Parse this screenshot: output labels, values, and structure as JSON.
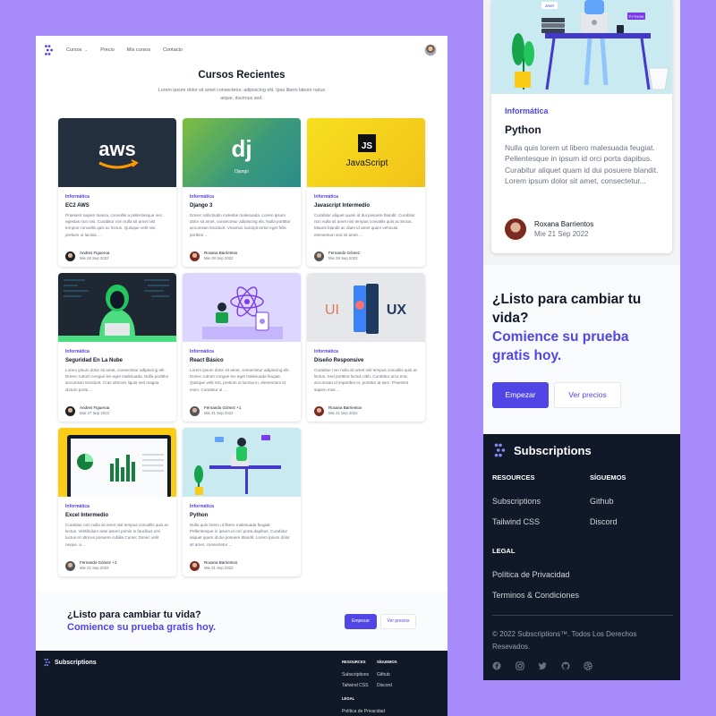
{
  "nav": {
    "links": [
      "Cursos",
      "Precio",
      "Mis cursos",
      "Contacto"
    ]
  },
  "hero": {
    "title": "Cursos Recientes",
    "subtitle": "Lorem ipsum dolor sit amet consectetur, adipisicing elit. Ipsa libero labore natus atque, ducimus sed."
  },
  "courses": [
    {
      "category": "Informática",
      "title": "EC2 AWS",
      "desc": "Praesent sapien massa, convallis a pellentesque nec, egestas non nisi. Curabitur non nulla sit amet nisl tempus convallis quis ac lectus. Quisque velit nisi, pretium ut lacinia ...",
      "author": "Andres Figueroa",
      "date": "Mie 28 Sep 2022",
      "image": "aws-logo"
    },
    {
      "category": "Informática",
      "title": "Django 3",
      "desc": "Donec sollicitudin molestie malesuada. Lorem ipsum dolor sit amet, consectetur adipiscing elit. Nulla porttitor accumsan tincidunt. Vivamus suscipit tortor eget felis porttitor ...",
      "author": "Roxana Barrientos",
      "date": "Mie 28 Sep 2022",
      "image": "django-logo"
    },
    {
      "category": "Informática",
      "title": "Javascript Intermedio",
      "desc": "Curabitur aliquet quam id dui posuere blandit. Curabitur non nulla sit amet nisl tempus convallis quis ac lectus. Mauris blandit ac diam id amet quam vehicula elementum sed sit amet ...",
      "author": "Fernando Gómez",
      "date": "Mie 28 Sep 2022",
      "image": "js-logo"
    },
    {
      "category": "Informática",
      "title": "Seguridad En La Nube",
      "desc": "Lorem ipsum dolor sit amet, consectetur adipiscing elit. Donec rutrum congue leo eget malesuada. Nulla porttitor accumsan tincidunt. Cras ultricies ligula sed magna dictum porta ...",
      "author": "Andres Figueroa",
      "date": "Mar 27 Sep 2022",
      "image": "hacker"
    },
    {
      "category": "Informática",
      "title": "React Básico",
      "desc": "Lorem ipsum dolor sit amet, consectetur adipiscing elit. Donec rutrum congue leo eget malesuada feugiat. Quisque velit nisi, pretium ut lacinia in, elementum id enim. Curabitur ul ...",
      "author": "Fernando Gómez +1",
      "date": "Mie 21 Sep 2022",
      "image": "react"
    },
    {
      "category": "Informática",
      "title": "Diseño Responsive",
      "desc": "Curabitur non nulla sit amet nisl tempus convallis quis ac lectus. Sed porttitor lectus nibh. Curabitur arcu erat, accumsan id imperdiet et, porttitor at sem. Praesent sapien mas ...",
      "author": "Roxana Barrientos",
      "date": "Mie 21 Sep 2022",
      "image": "uiux"
    },
    {
      "category": "Informática",
      "title": "Excel Intermedio",
      "desc": "Curabitur non nulla sit amet nisl tempus convallis quis ac lectus. Vestibulum ante ipsum primis in faucibus orci luctus et ultrices posuere cubilia Curae; Donec velit neque, a ...",
      "author": "Fernando Gómez +1",
      "date": "Mie 21 Sep 2022",
      "image": "excel"
    },
    {
      "category": "Informática",
      "title": "Python",
      "desc": "Nulla quis lorem ut libero malesuada feugiat. Pellentesque in ipsum id orci porta dapibus. Curabitur aliquet quam id dui posuere blandit. Lorem ipsum dolor sit amet, consectetur ...",
      "author": "Roxana Barrientos",
      "date": "Mie 21 Sep 2022",
      "image": "python"
    }
  ],
  "cta": {
    "line1_desktop": "¿Listo para cambiar tu vida?",
    "line2_desktop": "Comience su prueba gratis hoy.",
    "line1a_mobile": "¿Listo para cambiar tu",
    "line1b_mobile": "vida?",
    "line2a_mobile": "Comience su prueba",
    "line2b_mobile": "gratis hoy.",
    "primary": "Empezar",
    "secondary": "Ver precios"
  },
  "footer": {
    "brand": "Subscriptions",
    "resources_title": "RESOURCES",
    "resources": [
      "Subscriptions",
      "Tailwind CSS"
    ],
    "follow_title": "SÍGUEMOS",
    "follow": [
      "Github",
      "Discord"
    ],
    "legal_title": "LEGAL",
    "legal": [
      "Política de Privacidad",
      "Terminos & Condiciones"
    ],
    "copyright": "© 2022 Subscriptions™. Todos Los Derechos Resevados.",
    "social_icons": [
      "facebook-icon",
      "instagram-icon",
      "twitter-icon",
      "github-icon",
      "dribbble-icon"
    ]
  },
  "mobile_card": {
    "category": "Informática",
    "title": "Python",
    "desc": "Nulla quis lorem ut libero malesuada feugiat. Pellentesque in ipsum id orci porta dapibus. Curabitur aliquet quam id dui posuere blandit. Lorem ipsum dolor sit amet, consectetur...",
    "author": "Roxana Barrientos",
    "date": "Mie 21 Sep 2022",
    "image_badges": [
      "JAVA",
      "PYTHON"
    ]
  },
  "colors": {
    "accent": "#4f46e5",
    "background": "#a78bfa",
    "footer": "#111827"
  }
}
